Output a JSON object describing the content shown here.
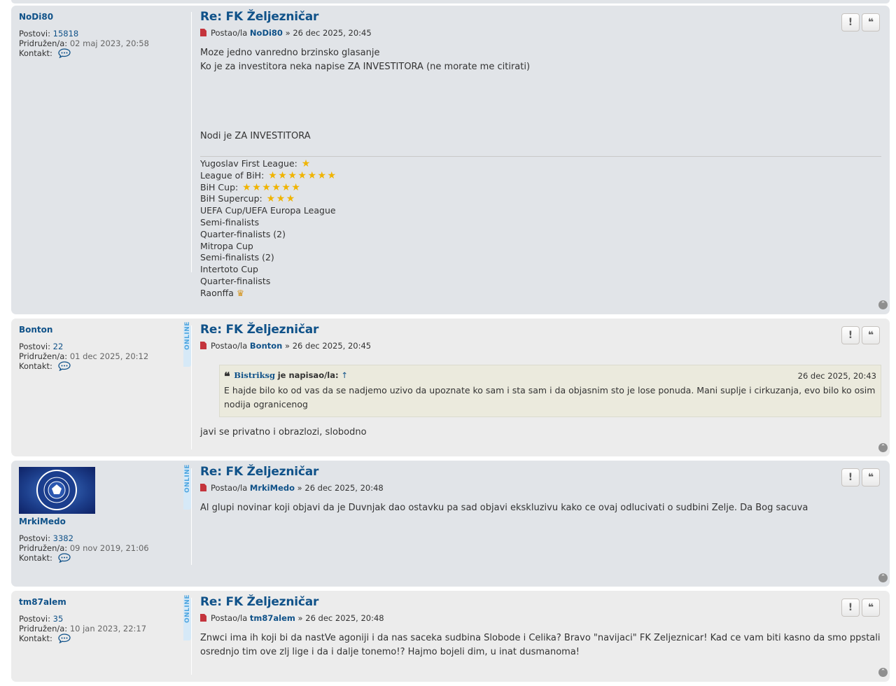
{
  "labels": {
    "posts": "Postovi:",
    "joined": "Pridružen/a:",
    "contact": "Kontakt:",
    "posted_by": "Postao/la",
    "sep": "»",
    "online": "ONLINE",
    "wrote": "je napisao/la:",
    "up_arrow": "↑",
    "report_btn": "!",
    "quote_btn": "❝",
    "top_btn": "⌃"
  },
  "posts": [
    {
      "username": "NoDi80",
      "post_count": "15818",
      "joined": "02 maj 2023, 20:58",
      "title": "Re: FK Željezničar",
      "author": "NoDi80",
      "date": "26 dec 2025, 20:45",
      "lines": [
        "Moze jedno vanredno brzinsko glasanje",
        "Ko je za investitora neka napise ZA INVESTITORA (ne morate me citirati)",
        "Nodi je ZA INVESTITORA"
      ],
      "signature": [
        {
          "text": "Yugoslav First League:",
          "stars": 1
        },
        {
          "text": "League of BiH:",
          "stars": 7
        },
        {
          "text": "BiH Cup:",
          "stars": 6
        },
        {
          "text": "BiH Supercup:",
          "stars": 3
        },
        {
          "text": "UEFA Cup/UEFA Europa League",
          "stars": 0
        },
        {
          "text": "Semi-finalists",
          "stars": 0
        },
        {
          "text": "Quarter-finalists (2)",
          "stars": 0
        },
        {
          "text": "Mitropa Cup",
          "stars": 0
        },
        {
          "text": "Semi-finalists (2)",
          "stars": 0
        },
        {
          "text": "Intertoto Cup",
          "stars": 0
        },
        {
          "text": "Quarter-finalists",
          "stars": 0
        },
        {
          "text": "Raonffa",
          "stars": 0
        }
      ]
    },
    {
      "username": "Bonton",
      "post_count": "22",
      "joined": "01 dec 2025, 20:12",
      "title": "Re: FK Željezničar",
      "author": "Bonton",
      "date": "26 dec 2025, 20:45",
      "quote": {
        "author": "Bistriksg",
        "date": "26 dec 2025, 20:43",
        "text": "E hajde bilo ko od vas da se nadjemo uzivo da upoznate ko sam i sta sam i da objasnim sto je lose ponuda. Mani suplje i cirkuzanja, evo bilo ko osim nodija ogranicenog"
      },
      "text": "javi se privatno i obrazlozi, slobodno"
    },
    {
      "username": "MrkiMedo",
      "post_count": "3382",
      "joined": "09 nov 2019, 21:06",
      "title": "Re: FK Željezničar",
      "author": "MrkiMedo",
      "date": "26 dec 2025, 20:48",
      "text": "Al glupi novinar koji objavi da je Duvnjak dao ostavku pa sad objavi ekskluzivu kako ce ovaj odlucivati o sudbini Zelje. Da Bog sacuva",
      "avatar_text": "FUDBALSKI KLUB ŽELJEZNIČAR FOOTBALL CLUB"
    },
    {
      "username": "tm87alem",
      "post_count": "35",
      "joined": "10 jan 2023, 22:17",
      "title": "Re: FK Željezničar",
      "author": "tm87alem",
      "date": "26 dec 2025, 20:48",
      "text": "Znwci ima ih koji bi da nastVe agoniji i da nas saceka sudbina Slobode i Celika? Bravo \"navijaci\" FK Zeljeznicar! Kad ce vam biti kasno da smo ppstali osrednjo tim ove zlj lige i da i dalje tonemo!? Hajmo bojeli dim, u inat dusmanoma!"
    }
  ],
  "colors": {
    "link": "#105289",
    "post_bg_dark": "#e1e4e8",
    "post_bg_light": "#ececec",
    "quote_bg": "#ebeadd",
    "star": "#f0b400",
    "online": "#4da5e0"
  }
}
